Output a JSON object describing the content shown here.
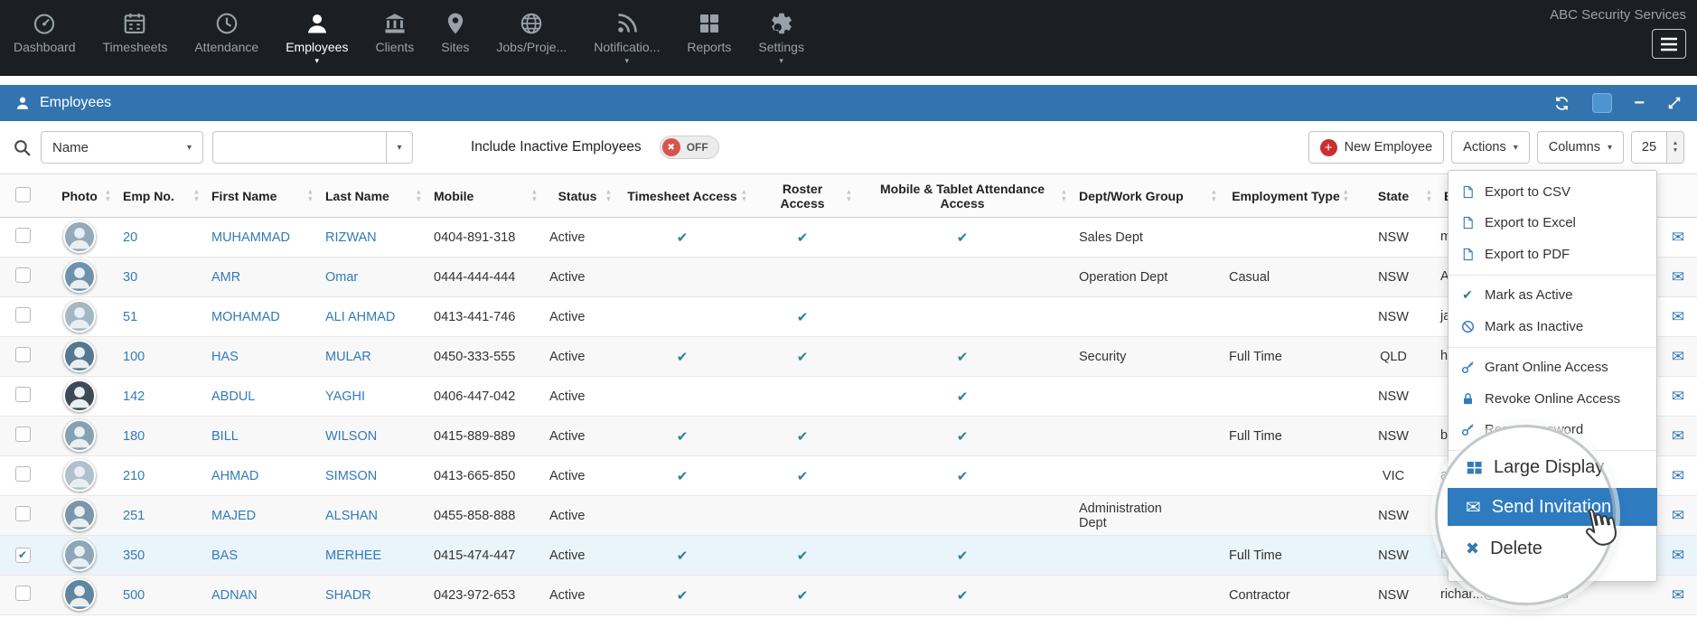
{
  "account": {
    "name": "ABC Security Services"
  },
  "nav": {
    "items": [
      {
        "id": "dashboard",
        "label": "Dashboard",
        "active": false,
        "caret": false
      },
      {
        "id": "timesheets",
        "label": "Timesheets",
        "active": false,
        "caret": false
      },
      {
        "id": "attendance",
        "label": "Attendance",
        "active": false,
        "caret": false
      },
      {
        "id": "employees",
        "label": "Employees",
        "active": true,
        "caret": true
      },
      {
        "id": "clients",
        "label": "Clients",
        "active": false,
        "caret": false
      },
      {
        "id": "sites",
        "label": "Sites",
        "active": false,
        "caret": false
      },
      {
        "id": "jobs",
        "label": "Jobs/Proje...",
        "active": false,
        "caret": false
      },
      {
        "id": "notifications",
        "label": "Notificatio...",
        "active": false,
        "caret": true
      },
      {
        "id": "reports",
        "label": "Reports",
        "active": false,
        "caret": false
      },
      {
        "id": "settings",
        "label": "Settings",
        "active": false,
        "caret": true
      }
    ]
  },
  "panel": {
    "title": "Employees"
  },
  "toolbar": {
    "search_field": "Name",
    "search_value": "",
    "include_inactive_label": "Include Inactive Employees",
    "toggle_state": "OFF",
    "new_employee": "New Employee",
    "actions": "Actions",
    "columns": "Columns",
    "page_size": "25"
  },
  "table": {
    "headers": [
      "",
      "Photo",
      "Emp No.",
      "First Name",
      "Last Name",
      "Mobile",
      "Status",
      "Timesheet Access",
      "Roster Access",
      "Mobile & Tablet Attendance Access",
      "Dept/Work Group",
      "Employment Type",
      "State",
      "E"
    ],
    "rows": [
      {
        "emp_no": "20",
        "first": "MUHAMMAD",
        "last": "RIZWAN",
        "mobile": "0404-891-318",
        "status": "Active",
        "timesheet": true,
        "roster": true,
        "attendance": true,
        "dept": "Sales Dept",
        "type": "",
        "state": "NSW",
        "email": "m",
        "selected": false
      },
      {
        "emp_no": "30",
        "first": "AMR",
        "last": "Omar",
        "mobile": "0444-444-444",
        "status": "Active",
        "timesheet": false,
        "roster": false,
        "attendance": false,
        "dept": "Operation Dept",
        "type": "Casual",
        "state": "NSW",
        "email": "A",
        "selected": false
      },
      {
        "emp_no": "51",
        "first": "MOHAMAD",
        "last": "ALI AHMAD",
        "mobile": "0413-441-746",
        "status": "Active",
        "timesheet": false,
        "roster": true,
        "attendance": false,
        "dept": "",
        "type": "",
        "state": "NSW",
        "email": "ja",
        "selected": false
      },
      {
        "emp_no": "100",
        "first": "HAS",
        "last": "MULAR",
        "mobile": "0450-333-555",
        "status": "Active",
        "timesheet": true,
        "roster": true,
        "attendance": true,
        "dept": "Security",
        "type": "Full Time",
        "state": "QLD",
        "email": "h",
        "selected": false
      },
      {
        "emp_no": "142",
        "first": "ABDUL",
        "last": "YAGHI",
        "mobile": "0406-447-042",
        "status": "Active",
        "timesheet": false,
        "roster": false,
        "attendance": true,
        "dept": "",
        "type": "",
        "state": "NSW",
        "email": "",
        "selected": false
      },
      {
        "emp_no": "180",
        "first": "BILL",
        "last": "WILSON",
        "mobile": "0415-889-889",
        "status": "Active",
        "timesheet": true,
        "roster": true,
        "attendance": true,
        "dept": "",
        "type": "Full Time",
        "state": "NSW",
        "email": "b",
        "selected": false
      },
      {
        "emp_no": "210",
        "first": "AHMAD",
        "last": "SIMSON",
        "mobile": "0413-665-850",
        "status": "Active",
        "timesheet": true,
        "roster": true,
        "attendance": true,
        "dept": "",
        "type": "",
        "state": "VIC",
        "email": "a",
        "selected": false
      },
      {
        "emp_no": "251",
        "first": "MAJED",
        "last": "ALSHAN",
        "mobile": "0455-858-888",
        "status": "Active",
        "timesheet": false,
        "roster": false,
        "attendance": false,
        "dept": "Administration Dept",
        "type": "",
        "state": "NSW",
        "email": "",
        "selected": false
      },
      {
        "emp_no": "350",
        "first": "BAS",
        "last": "MERHEE",
        "mobile": "0415-474-447",
        "status": "Active",
        "timesheet": true,
        "roster": true,
        "attendance": true,
        "dept": "",
        "type": "Full Time",
        "state": "NSW",
        "email": "b",
        "selected": true
      },
      {
        "emp_no": "500",
        "first": "ADNAN",
        "last": "SHADR",
        "mobile": "0423-972-653",
        "status": "Active",
        "timesheet": true,
        "roster": true,
        "attendance": true,
        "dept": "",
        "type": "Contractor",
        "state": "NSW",
        "email": "richar...@gu....com.au",
        "selected": false
      }
    ]
  },
  "actions_menu": {
    "items": [
      {
        "label": "Export to CSV",
        "icon": "file-icon",
        "divider_after": false
      },
      {
        "label": "Export to Excel",
        "icon": "file-icon",
        "divider_after": false
      },
      {
        "label": "Export to PDF",
        "icon": "file-icon",
        "divider_after": true
      },
      {
        "label": "Mark as Active",
        "icon": "check-icon",
        "divider_after": false
      },
      {
        "label": "Mark as Inactive",
        "icon": "ban-icon",
        "divider_after": true
      },
      {
        "label": "Grant Online Access",
        "icon": "key-icon",
        "divider_after": false
      },
      {
        "label": "Revoke Online Access",
        "icon": "lock-icon",
        "divider_after": false
      },
      {
        "label": "Reset Password",
        "icon": "key-icon",
        "divider_after": true
      }
    ],
    "magnified_items": [
      {
        "label": "Large Display",
        "icon": "grid-icon",
        "selected": false
      },
      {
        "label": "Send Invitation",
        "icon": "envelope-icon",
        "selected": true
      },
      {
        "label": "Delete",
        "icon": "x-icon",
        "selected": false
      }
    ]
  }
}
